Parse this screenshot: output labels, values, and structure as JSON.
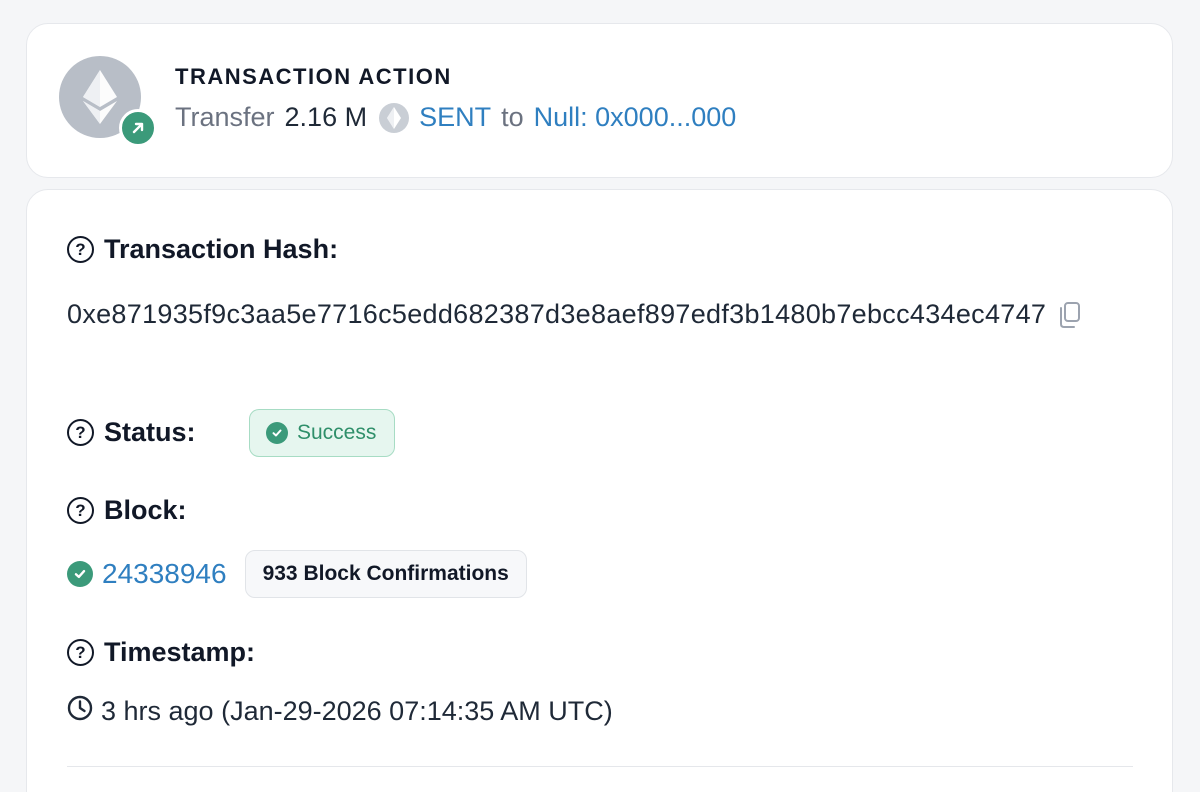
{
  "action": {
    "title": "TRANSACTION ACTION",
    "verb": "Transfer",
    "amount": "2.16 M",
    "token": "SENT",
    "to_word": "to",
    "recipient": "Null: 0x000...000",
    "avatar_icon": "ethereum-icon",
    "badge_icon": "arrow-up-right-icon"
  },
  "details": {
    "hash_label": "Transaction Hash:",
    "hash_value": "0xe871935f9c3aa5e7716c5edd682387d3e8aef897edf3b1480b7ebcc434ec4747",
    "status_label": "Status:",
    "status_value": "Success",
    "block_label": "Block:",
    "block_number": "24338946",
    "block_confirmations": "933 Block Confirmations",
    "timestamp_label": "Timestamp:",
    "timestamp_value": "3 hrs ago (Jan-29-2026 07:14:35 AM UTC)"
  },
  "colors": {
    "link": "#2f7fc0",
    "success": "#3b9a7a",
    "success_bg": "#e6f6ef"
  }
}
